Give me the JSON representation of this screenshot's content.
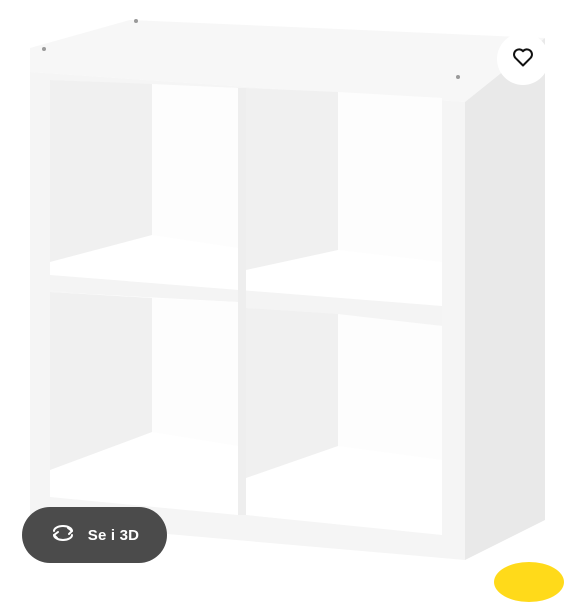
{
  "product_image": {
    "subject": "white-cube-shelving-unit"
  },
  "favorite_button": {
    "icon": "heart-icon"
  },
  "view_3d_button": {
    "icon": "rotate-arrows-icon",
    "label": "Se i 3D"
  },
  "colors": {
    "panel_color": "#ffffff",
    "view3d_bg": "#4b4b4b",
    "accent_yellow": "#ffda1a"
  }
}
